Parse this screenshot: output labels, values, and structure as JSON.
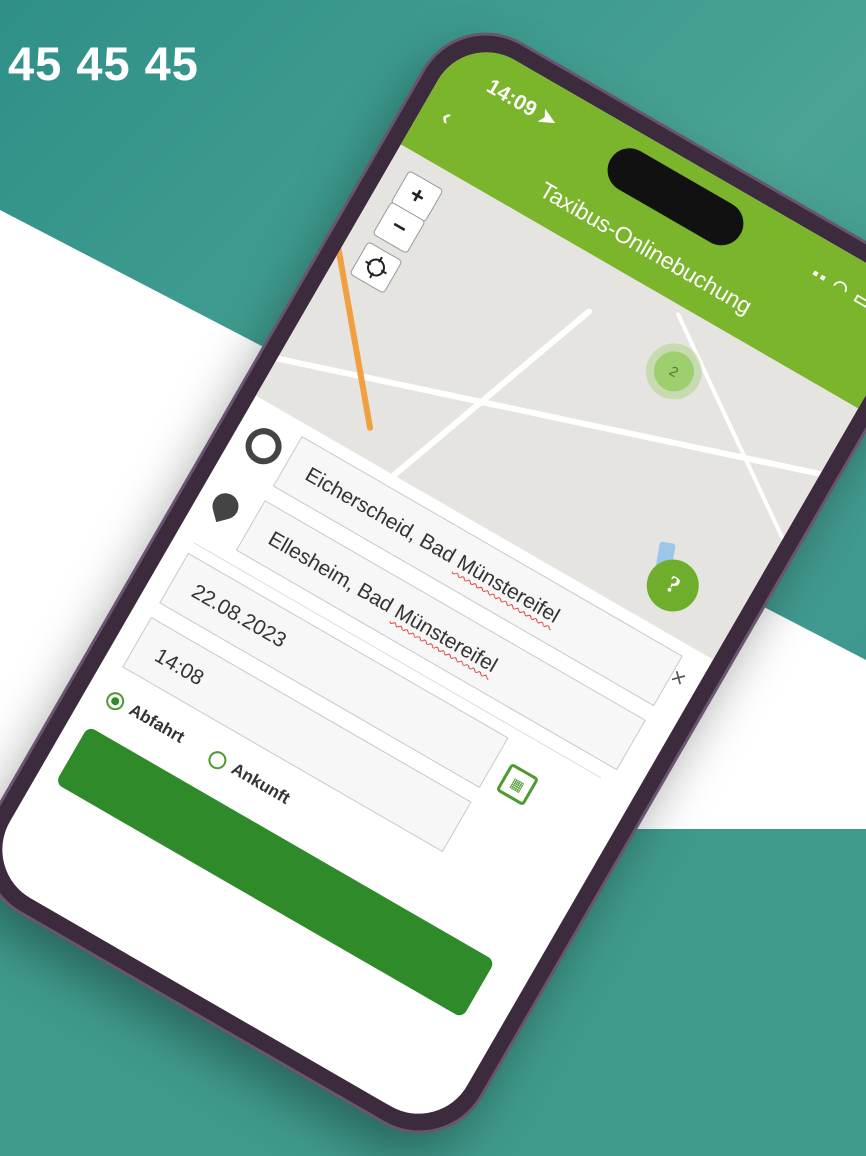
{
  "hotline": {
    "number": "45 45 45"
  },
  "phone": {
    "status": {
      "time": "14:09 ➤",
      "icons": "▪▪ ◠ ▭"
    },
    "appbar": {
      "back_label": "‹",
      "title": "Taxibus-Onlinebuchung"
    },
    "map": {
      "zoom_in": "+",
      "zoom_out": "−",
      "locate_icon": "crosshair-icon",
      "cluster_count": "2",
      "help_label": "?"
    },
    "form": {
      "origin": "Eicherscheid, Bad Münstereifel",
      "destination": "Ellesheim, Bad Münstereifel",
      "date": "22.08.2023",
      "time": "14:08",
      "clear_label": "×",
      "calendar_icon": "calendar-icon",
      "mode_options": [
        {
          "label": "Abfahrt",
          "selected": true
        },
        {
          "label": "Ankunft",
          "selected": false
        }
      ]
    },
    "colors": {
      "appbar": "#7bb52c",
      "accent": "#2f8a2a",
      "background": "#3f9a8c"
    }
  }
}
